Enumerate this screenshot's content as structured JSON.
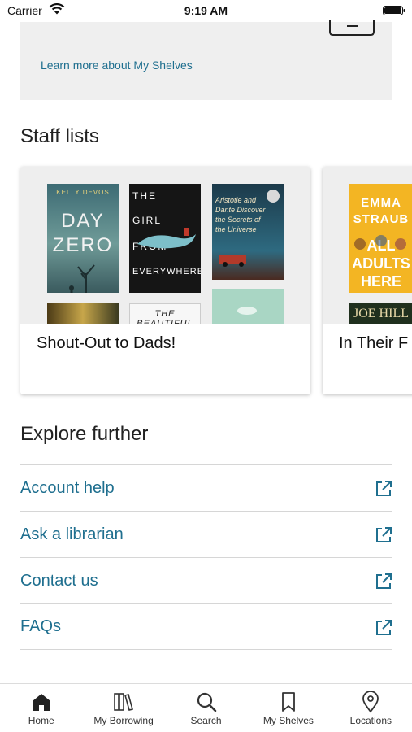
{
  "status_bar": {
    "carrier": "Carrier",
    "time": "9:19 AM"
  },
  "shelves_banner": {
    "link": "Learn more about My Shelves"
  },
  "staff_lists": {
    "title": "Staff lists",
    "cards": [
      {
        "title": "Shout-Out to Dads!",
        "covers": [
          {
            "author": "KELLY DEVOS",
            "title_1": "DAY",
            "title_2": "ZERO"
          },
          {
            "title_1": "THE",
            "title_2": "GIRL",
            "title_3": "FROM",
            "title_4": "EVERYWHERE"
          },
          {
            "title": "Aristotle and Dante Discover the Secrets of the Universe"
          },
          {
            "title": ""
          },
          {
            "title": "THE BEAUTIFUL"
          },
          {
            "title": ""
          }
        ]
      },
      {
        "title": "In Their F",
        "covers": [
          {
            "author": "EMMA STRAUB",
            "title_1": "ALL",
            "title_2": "ADULTS",
            "title_3": "HERE"
          },
          {
            "author": "JOE HILL"
          }
        ]
      }
    ]
  },
  "explore": {
    "title": "Explore further",
    "items": [
      {
        "label": "Account help"
      },
      {
        "label": "Ask a librarian"
      },
      {
        "label": "Contact us"
      },
      {
        "label": "FAQs"
      }
    ]
  },
  "tab_bar": {
    "tabs": [
      {
        "label": "Home",
        "icon": "home-icon"
      },
      {
        "label": "My Borrowing",
        "icon": "books-icon"
      },
      {
        "label": "Search",
        "icon": "search-icon"
      },
      {
        "label": "My Shelves",
        "icon": "bookmark-icon"
      },
      {
        "label": "Locations",
        "icon": "location-pin-icon"
      }
    ]
  },
  "colors": {
    "link": "#1f6f8f",
    "card_bg": "#eeeeee",
    "divider": "#d6d6d6"
  }
}
